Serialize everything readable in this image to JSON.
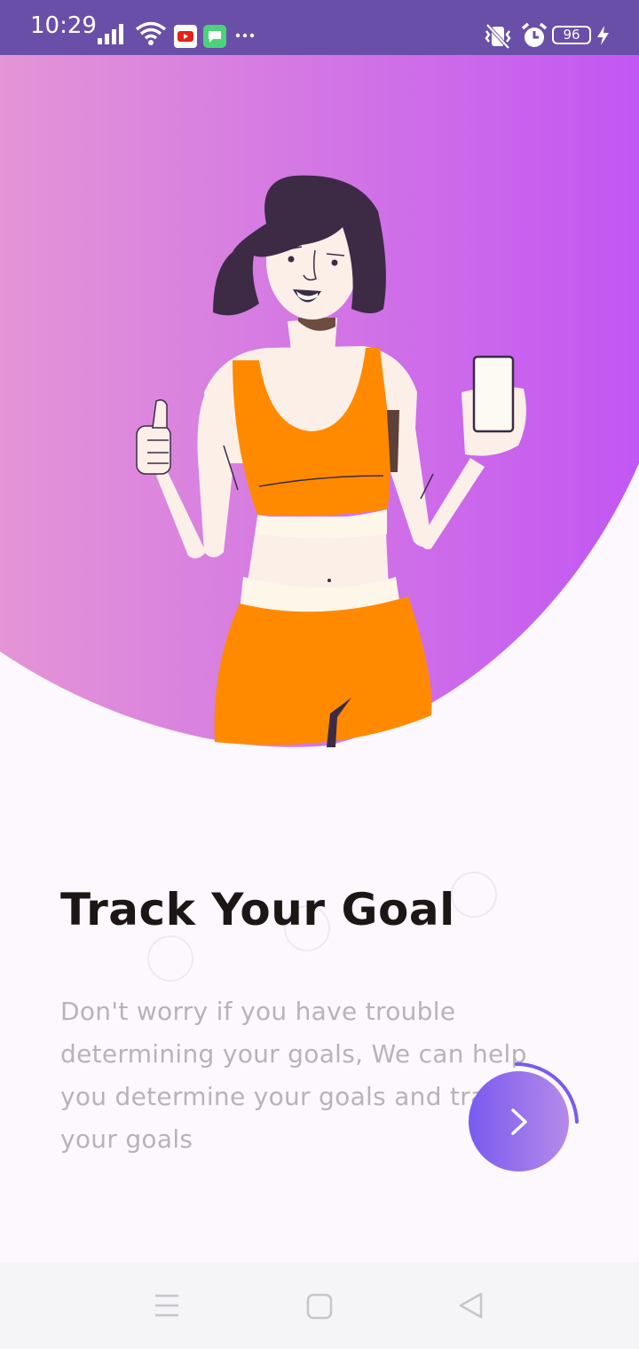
{
  "status_bar": {
    "time": "10:29",
    "battery_level": "96",
    "left_icons": [
      "signal-icon",
      "wifi-icon",
      "youtube-icon",
      "messages-icon",
      "more-notifications-icon"
    ],
    "right_icons": [
      "vibrate-icon",
      "alarm-icon",
      "battery-icon",
      "charging-icon"
    ]
  },
  "onboarding": {
    "title": "Track Your Goal",
    "description": "Don't worry if you have trouble determining your goals, We can help you determine your goals and track your goals",
    "illustration": "woman-thumbs-up-holding-phone",
    "step_progress": 0.25
  },
  "nav_bar": {
    "icons": [
      "menu-icon",
      "home-icon",
      "back-icon"
    ]
  },
  "colors": {
    "status_bar": "#6a4fa8",
    "hero_gradient_start": "#e495d6",
    "hero_gradient_end": "#c257f3",
    "title": "#1d1617",
    "description": "#b7b3ba",
    "button_start": "#7a5af0",
    "button_end": "#b58ae8",
    "top_orange": "#ff8a00"
  }
}
